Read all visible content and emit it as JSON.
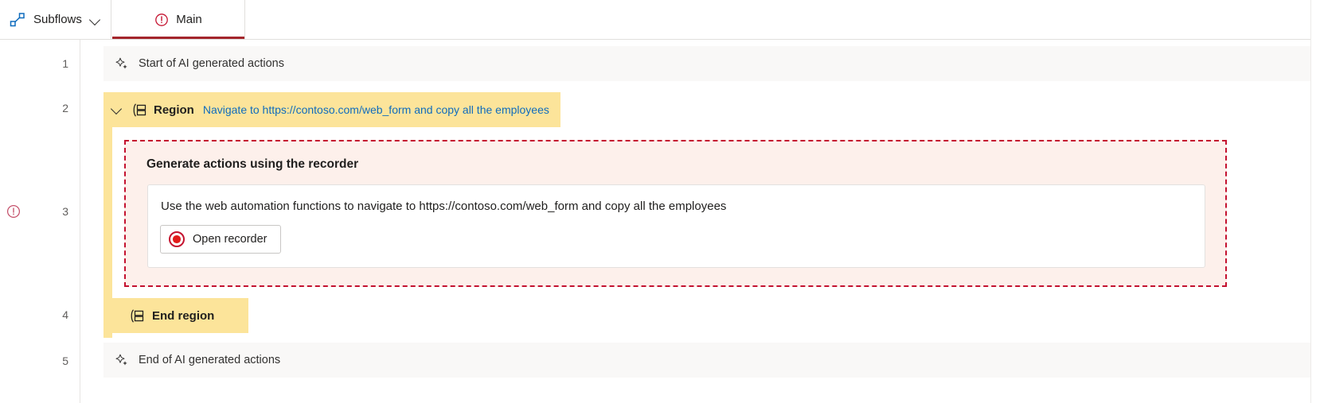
{
  "tabs": {
    "subflows": {
      "label": "Subflows",
      "icon": "subflow-icon",
      "chevron": "chevron-down-icon"
    },
    "main": {
      "label": "Main",
      "icon": "error-circle-icon",
      "active": true,
      "accent": "#a4262c"
    }
  },
  "gutter": {
    "line_numbers": [
      "1",
      "2",
      "3",
      "4",
      "5"
    ],
    "error_marker_line": "3",
    "error_icon": "error-circle-icon"
  },
  "colors": {
    "region_yellow": "#fce49a",
    "recorder_border": "#c4122f",
    "recorder_bg": "#fdf0eb",
    "link_blue": "#0f6cbd",
    "ai_row_bg": "#f9f8f7",
    "record_red": "#e21b1b"
  },
  "rows": {
    "ai_start": {
      "label": "Start of AI generated actions",
      "icon": "sparkle-ai-icon"
    },
    "region": {
      "collapse_icon": "chevron-down-icon",
      "icon": "region-icon",
      "title": "Region",
      "description": "Navigate to https://contoso.com/web_form and copy all the employees"
    },
    "end_region": {
      "label": "End region",
      "icon": "region-icon"
    },
    "ai_end": {
      "label": "End of AI generated actions",
      "icon": "sparkle-ai-icon"
    }
  },
  "recorder": {
    "title": "Generate actions using the recorder",
    "prompt": "Use the web automation functions to navigate to https://contoso.com/web_form and copy all the employees",
    "button_label": "Open recorder",
    "button_icon": "record-dot-icon"
  }
}
